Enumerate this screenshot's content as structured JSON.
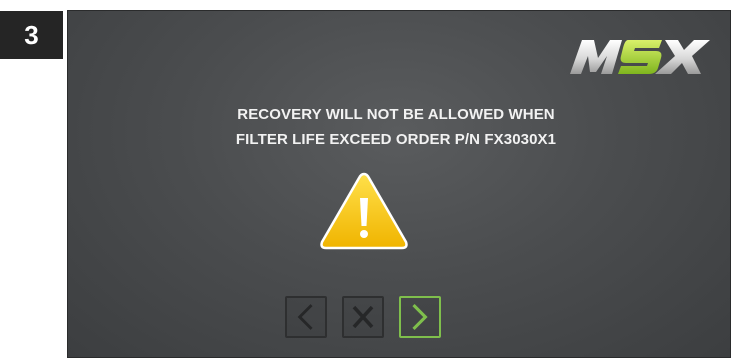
{
  "step": {
    "number": "3"
  },
  "screen": {
    "logo_text": "MSX",
    "message_line1": "RECOVERY WILL NOT BE ALLOWED WHEN",
    "message_line2": "FILTER LIFE EXCEED ORDER P/N FX3030X1",
    "warning_icon": "warning-triangle-icon",
    "nav": {
      "back_icon": "chevron-left-icon",
      "cancel_icon": "x-icon",
      "next_icon": "chevron-right-icon"
    }
  },
  "colors": {
    "screen_background": "#4b4d4f",
    "warning_yellow": "#f5c315",
    "next_green": "#7fbf4c",
    "inactive_icon": "#262728",
    "text": "#f2f2f2"
  }
}
